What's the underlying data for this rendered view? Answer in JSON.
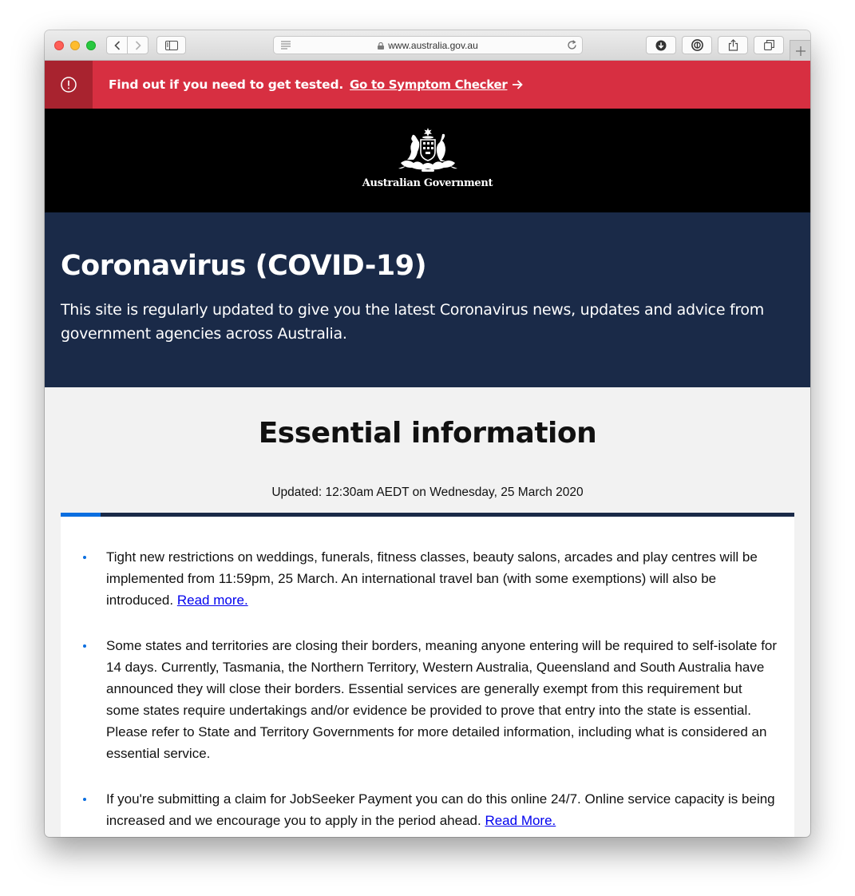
{
  "browser": {
    "url": "www.australia.gov.au"
  },
  "alert": {
    "text": "Find out if you need to get tested.",
    "link": "Go to Symptom Checker"
  },
  "header": {
    "government_name": "Australian Government"
  },
  "hero": {
    "title": "Coronavirus (COVID-19)",
    "description": "This site is regularly updated to give you the latest Coronavirus news, updates and advice from government agencies across Australia."
  },
  "essential": {
    "title": "Essential information",
    "updated": "Updated: 12:30am AEDT on Wednesday, 25 March 2020",
    "items": [
      {
        "text": "Tight new restrictions on weddings, funerals, fitness classes, beauty salons, arcades and play centres will be implemented from 11:59pm, 25 March. An international travel ban (with some exemptions) will also be introduced. ",
        "link": "Read more."
      },
      {
        "text": "Some states and territories are closing their borders, meaning anyone entering will be required to self-isolate for 14 days. Currently, Tasmania, the Northern Territory, Western Australia, Queensland and South Australia have announced they will close their borders. Essential services are generally exempt from this requirement but some states require undertakings and/or evidence be provided to prove that entry into the state is essential. Please refer to State and Territory Governments for more detailed information, including what is considered an essential service.",
        "link": ""
      },
      {
        "text": "If you're submitting a claim for JobSeeker Payment you can do this online 24/7. Online service capacity is being increased and we encourage you to apply in the period ahead. ",
        "link": "Read More."
      }
    ]
  },
  "colors": {
    "alert_red": "#d72f41",
    "alert_icon_bg": "#a8232f",
    "gov_black": "#000000",
    "hero_navy": "#1a2a48",
    "accent_blue": "#0a6ee0",
    "link_blue": "#0000ee",
    "page_grey": "#f2f2f2"
  },
  "icons": {
    "alert": "exclamation-circle-icon",
    "arrow": "arrow-right-icon",
    "crest": "commonwealth-coat-of-arms"
  }
}
